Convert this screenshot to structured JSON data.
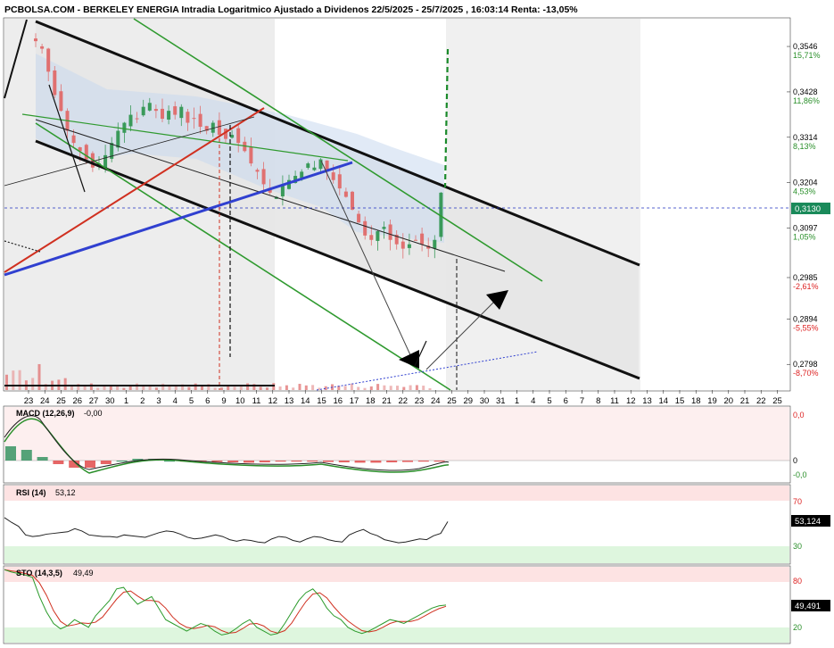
{
  "header": {
    "title": "PCBOLSA.COM - BERKELEY ENERGIA Intradia Logaritmico Ajustado a Dividenos 22/5/2025 - 25/7/2025 , 16:03:14 Renta: -13,05%"
  },
  "colors": {
    "up": "#3a9a5a",
    "down": "#e07070",
    "channel_green": "#2f9a2f",
    "trend_blue": "#3040d0",
    "trend_red": "#d03020",
    "price_line": "#2030c0",
    "last_price_tag": "#1a8a5a"
  },
  "price_axis": {
    "levels": [
      {
        "price": "0,3546",
        "pct": "15,71%",
        "dir": "up"
      },
      {
        "price": "0,3428",
        "pct": "11,86%",
        "dir": "up"
      },
      {
        "price": "0,3314",
        "pct": "8,13%",
        "dir": "up"
      },
      {
        "price": "0,3204",
        "pct": "4,53%",
        "dir": "up"
      },
      {
        "price": "0,3097",
        "pct": "1,05%",
        "dir": "up"
      },
      {
        "price": "0,2985",
        "pct": "-2,61%",
        "dir": "down"
      },
      {
        "price": "0,2894",
        "pct": "-5,55%",
        "dir": "down"
      },
      {
        "price": "0,2798",
        "pct": "-8,70%",
        "dir": "down"
      }
    ],
    "last_price": "0,3130"
  },
  "x_axis": {
    "ticks": [
      "23",
      "24",
      "25",
      "26",
      "27",
      "30",
      "1",
      "2",
      "3",
      "4",
      "5",
      "6",
      "9",
      "10",
      "11",
      "12",
      "13",
      "14",
      "15",
      "16",
      "17",
      "18",
      "21",
      "22",
      "23",
      "24",
      "25",
      "29",
      "30",
      "31",
      "1",
      "4",
      "5",
      "6",
      "7",
      "8",
      "11",
      "12",
      "13",
      "14",
      "15",
      "18",
      "19",
      "20",
      "21",
      "22",
      "25"
    ]
  },
  "macd": {
    "label": "MACD (12,26,9)",
    "value": "-0,00",
    "levels": [
      "0,0",
      "0",
      "-0,0"
    ]
  },
  "rsi": {
    "label": "RSI (14)",
    "value": "53,12",
    "levels": [
      "70",
      "30"
    ],
    "tag": "53,124"
  },
  "sto": {
    "label": "STO (14,3,5)",
    "value": "49,49",
    "levels": [
      "80",
      "20"
    ],
    "tag": "49,491"
  },
  "chart_data": {
    "type": "candlestick",
    "title": "PCBOLSA.COM - BERKELEY ENERGIA Intradia Logaritmico Ajustado a Dividenos 22/5/2025 - 25/7/2025 , 16:03:14 Renta: -13,05%",
    "scale": "log",
    "ylim": [
      0.2745,
      0.362
    ],
    "last_price": 0.313,
    "series": [
      {
        "name": "close",
        "values": [
          0.356,
          0.354,
          0.348,
          0.342,
          0.338,
          0.333,
          0.33,
          0.328,
          0.326,
          0.324,
          0.325,
          0.327,
          0.33,
          0.333,
          0.335,
          0.337,
          0.336,
          0.339,
          0.34,
          0.338,
          0.336,
          0.338,
          0.337,
          0.339,
          0.335,
          0.336,
          0.334,
          0.333,
          0.335,
          0.332,
          0.331,
          0.332,
          0.33,
          0.328,
          0.325,
          0.323,
          0.32,
          0.318,
          0.317,
          0.32,
          0.321,
          0.322,
          0.323,
          0.325,
          0.324,
          0.326,
          0.323,
          0.321,
          0.319,
          0.317,
          0.314,
          0.311,
          0.308,
          0.307,
          0.309,
          0.31,
          0.307,
          0.306,
          0.305,
          0.306,
          0.307,
          0.306,
          0.305,
          0.307,
          0.318
        ]
      },
      {
        "name": "MACD",
        "values": [
          0.004,
          0.003,
          0.001,
          -0.001,
          -0.002,
          -0.002,
          -0.001,
          0,
          0.0005,
          0.0005,
          0,
          -0.0002,
          -0.0003,
          -0.0004,
          -0.0005,
          -0.0006,
          -0.0005,
          -0.0003,
          -0.0002,
          -0.0003,
          -0.0004,
          -0.0005,
          -0.0006,
          -0.0006,
          -0.0005,
          -0.0004,
          -0.0003,
          -0.0001
        ]
      },
      {
        "name": "RSI",
        "values": [
          58,
          52,
          47,
          36,
          34,
          35,
          37,
          38,
          39,
          40,
          44,
          41,
          36,
          35,
          34,
          34,
          33,
          36,
          35,
          34,
          33,
          36,
          39,
          41,
          40,
          37,
          33,
          31,
          32,
          34,
          36,
          34,
          30,
          28,
          30,
          29,
          27,
          26,
          31,
          34,
          33,
          29,
          27,
          31,
          34,
          33,
          30,
          28,
          27,
          36,
          40,
          43,
          38,
          35,
          30,
          28,
          26,
          27,
          29,
          31,
          30,
          35,
          38,
          53
        ]
      },
      {
        "name": "STO",
        "values": [
          95,
          92,
          90,
          88,
          85,
          60,
          40,
          25,
          18,
          22,
          30,
          25,
          20,
          35,
          45,
          55,
          70,
          72,
          60,
          50,
          55,
          60,
          45,
          30,
          25,
          20,
          15,
          20,
          25,
          22,
          15,
          10,
          12,
          18,
          25,
          30,
          20,
          15,
          10,
          12,
          25,
          40,
          55,
          65,
          70,
          60,
          45,
          35,
          30,
          20,
          15,
          12,
          15,
          20,
          25,
          30,
          28,
          25,
          30,
          35,
          40,
          45,
          48,
          49
        ]
      }
    ]
  }
}
